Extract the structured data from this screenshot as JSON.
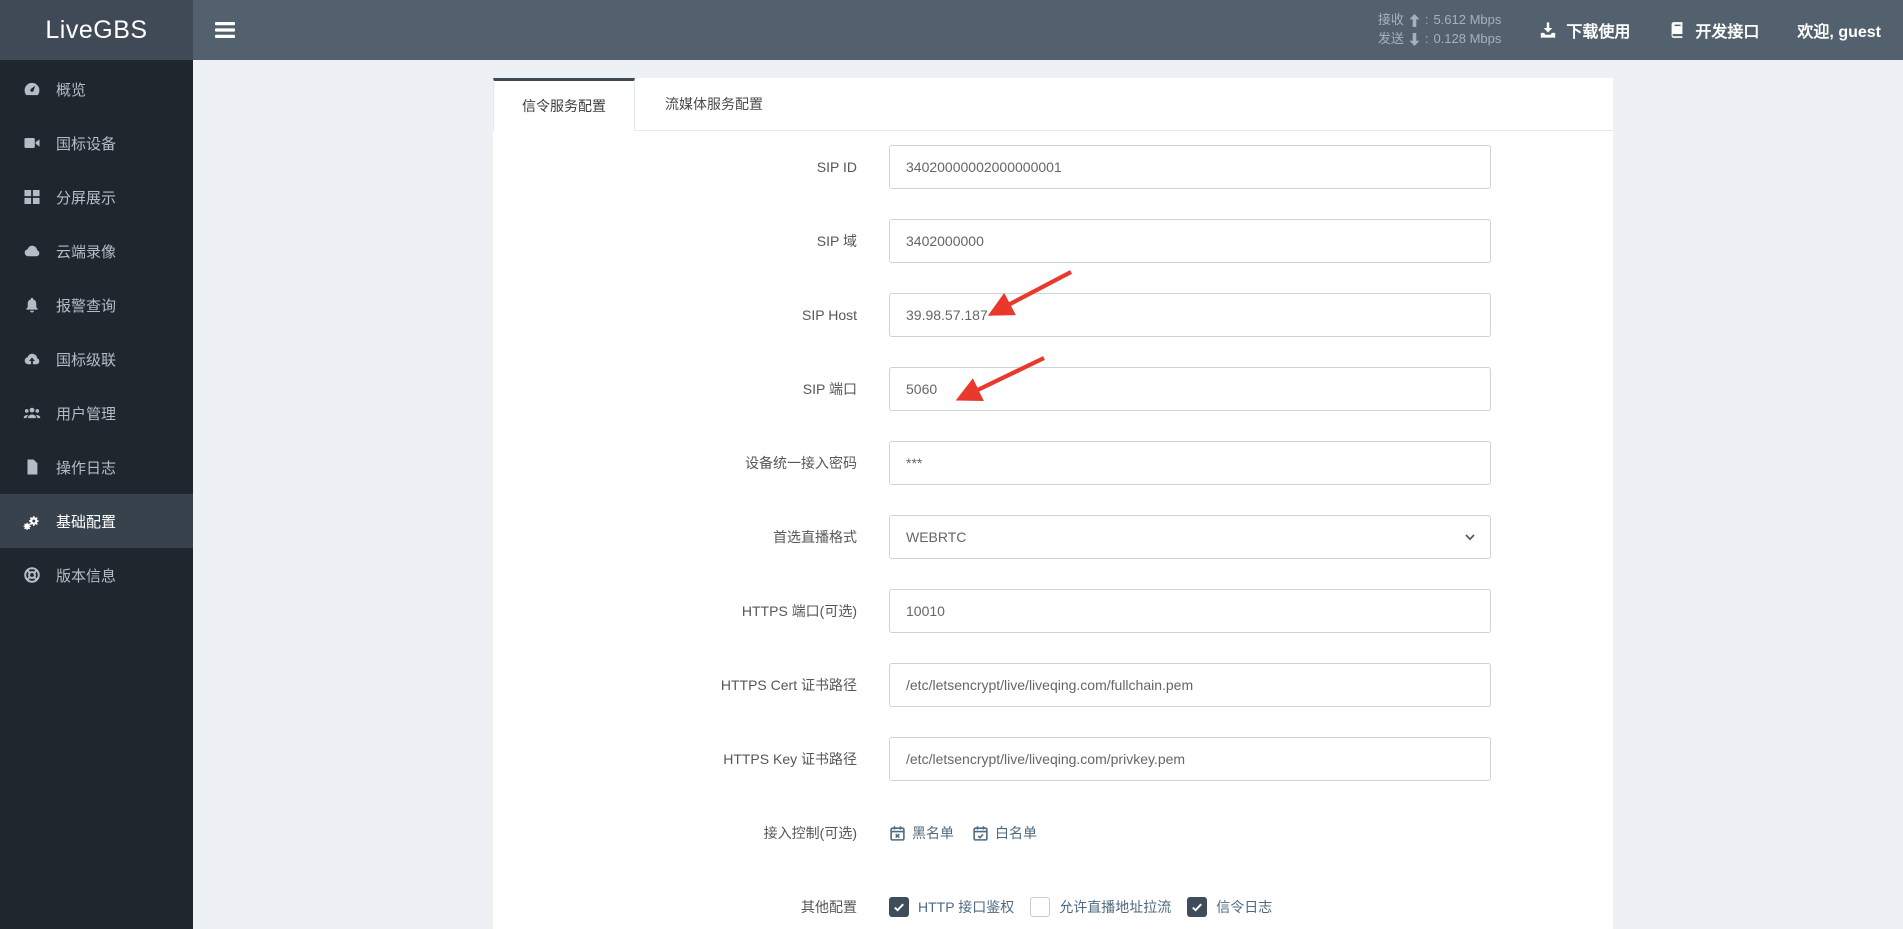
{
  "colors": {
    "header_bg": "#53616e",
    "logo_bg": "#3f4a56",
    "sidebar_bg": "#1f262e",
    "sidebar_active_bg": "#38424d",
    "content_bg": "#edf0f4",
    "tab_active_border": "#3d4a57",
    "link_color": "#4e6a80",
    "checkbox_checked_bg": "#3f4c59",
    "annotation_red": "#e8392c"
  },
  "header": {
    "brand": "LiveGBS",
    "separator": ":",
    "stats": [
      {
        "label": "接收",
        "direction": "up",
        "value": "5.612 Mbps"
      },
      {
        "label": "发送",
        "direction": "down",
        "value": "0.128 Mbps"
      }
    ],
    "actions": [
      {
        "label": "下载使用",
        "icon": "download-icon"
      },
      {
        "label": "开发接口",
        "icon": "book-icon"
      }
    ],
    "welcome": "欢迎, guest"
  },
  "sidebar": {
    "items": [
      {
        "label": "概览",
        "icon": "dashboard-icon",
        "active": false
      },
      {
        "label": "国标设备",
        "icon": "video-camera-icon",
        "active": false
      },
      {
        "label": "分屏展示",
        "icon": "grid-icon",
        "active": false
      },
      {
        "label": "云端录像",
        "icon": "cloud-icon",
        "active": false
      },
      {
        "label": "报警查询",
        "icon": "bell-icon",
        "active": false
      },
      {
        "label": "国标级联",
        "icon": "cloud-upload-icon",
        "active": false
      },
      {
        "label": "用户管理",
        "icon": "users-icon",
        "active": false
      },
      {
        "label": "操作日志",
        "icon": "file-icon",
        "active": false
      },
      {
        "label": "基础配置",
        "icon": "cogs-icon",
        "active": true
      },
      {
        "label": "版本信息",
        "icon": "life-ring-icon",
        "active": false
      }
    ]
  },
  "main": {
    "tabs": [
      {
        "label": "信令服务配置",
        "active": true
      },
      {
        "label": "流媒体服务配置",
        "active": false
      }
    ],
    "form": {
      "rows": [
        {
          "name": "sip-id",
          "label": "SIP ID",
          "type": "input",
          "value": "34020000002000000001"
        },
        {
          "name": "sip-domain",
          "label": "SIP 域",
          "type": "input",
          "value": "3402000000"
        },
        {
          "name": "sip-host",
          "label": "SIP Host",
          "type": "input",
          "value": "39.98.57.187",
          "annotated": true
        },
        {
          "name": "sip-port",
          "label": "SIP 端口",
          "type": "input",
          "value": "5060",
          "annotated": true
        },
        {
          "name": "device-access-password",
          "label": "设备统一接入密码",
          "type": "input",
          "value": "***"
        },
        {
          "name": "preferred-live-format",
          "label": "首选直播格式",
          "type": "select",
          "value": "WEBRTC"
        },
        {
          "name": "https-port",
          "label": "HTTPS 端口(可选)",
          "type": "input",
          "value": "10010"
        },
        {
          "name": "https-cert-path",
          "label": "HTTPS Cert 证书路径",
          "type": "input",
          "value": "/etc/letsencrypt/live/liveqing.com/fullchain.pem"
        },
        {
          "name": "https-key-path",
          "label": "HTTPS Key 证书路径",
          "type": "input",
          "value": "/etc/letsencrypt/live/liveqing.com/privkey.pem"
        },
        {
          "name": "access-control",
          "label": "接入控制(可选)",
          "type": "links",
          "links": [
            {
              "name": "blacklist",
              "label": "黑名单",
              "icon": "calendar-x-icon"
            },
            {
              "name": "whitelist",
              "label": "白名单",
              "icon": "calendar-check-icon"
            }
          ]
        },
        {
          "name": "other-config",
          "label": "其他配置",
          "type": "checkboxes",
          "options": [
            {
              "name": "http-api-auth",
              "label": "HTTP 接口鉴权",
              "checked": true
            },
            {
              "name": "allow-url-pull",
              "label": "允许直播地址拉流",
              "checked": false
            },
            {
              "name": "signaling-log",
              "label": "信令日志",
              "checked": true
            }
          ]
        }
      ]
    }
  }
}
